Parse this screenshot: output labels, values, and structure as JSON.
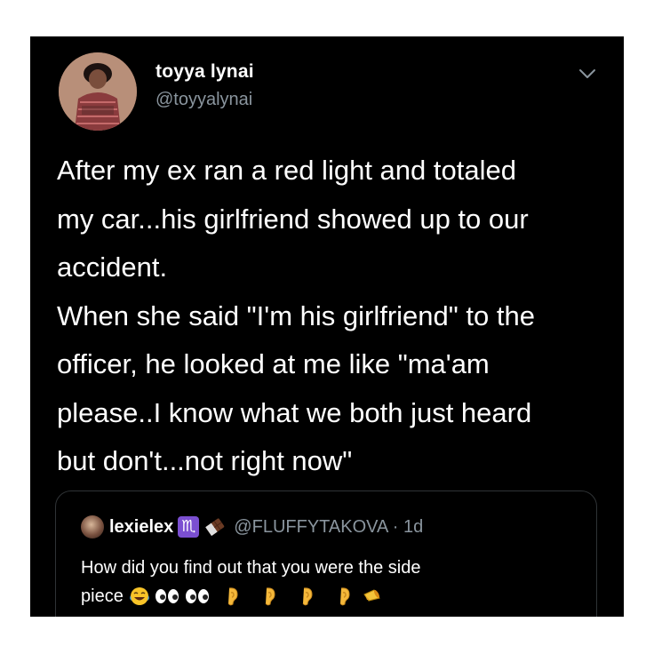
{
  "tweet": {
    "display_name": "toyya lynai",
    "handle": "@toyyalynai",
    "body_lines": [
      "After my ex ran a red light and totaled",
      "my car...his girlfriend showed up to our",
      "accident.",
      "When she said \"I'm his girlfriend\" to the",
      "officer, he looked at me like \"ma'am",
      "please..I know what we both just heard",
      "but don't...not right now\""
    ],
    "menu_icon": "chevron-down-icon"
  },
  "quoted_tweet": {
    "display_name": "lexielex",
    "zodiac_glyph": "♏",
    "handle_time": "@FLUFFYTAKOVA · 1d",
    "text_line1": "How did you find out that you were the side",
    "text_line2": "piece",
    "emojis": [
      "laughing-crying-emoji",
      "eyes-emoji",
      "eyes-emoji",
      "ear-emoji",
      "ear-emoji",
      "ear-emoji",
      "ear-emoji",
      "megaphone-emoji"
    ]
  },
  "colors": {
    "background": "#000000",
    "text_primary": "#ffffff",
    "text_secondary": "#8a959e",
    "quote_border": "#2f3336"
  }
}
